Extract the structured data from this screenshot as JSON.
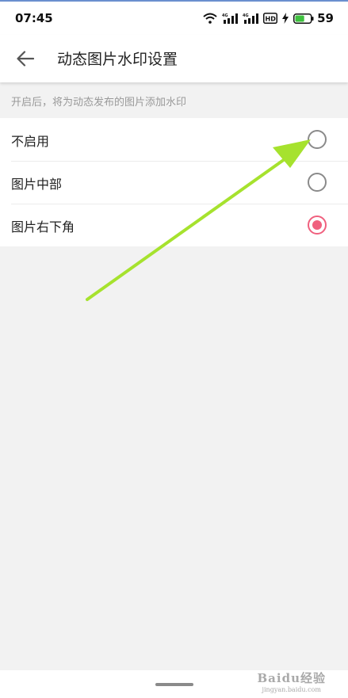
{
  "status_bar": {
    "time": "07:45",
    "network_1": "4G",
    "network_2": "4G",
    "hd_label": "HD",
    "battery_level": "59",
    "battery_color": "#3ec23e"
  },
  "header": {
    "back_icon": "arrow-left-icon",
    "title": "动态图片水印设置"
  },
  "hint": "开启后，将为动态发布的图片添加水印",
  "options": [
    {
      "label": "不启用",
      "selected": false
    },
    {
      "label": "图片中部",
      "selected": false
    },
    {
      "label": "图片右下角",
      "selected": true
    }
  ],
  "accent_color": "#f0607e",
  "annotation_arrow": {
    "color": "#a6e22e",
    "points_to": "不启用"
  },
  "watermark": {
    "logo": "Baidu经验",
    "url": "jingyan.baidu.com"
  }
}
